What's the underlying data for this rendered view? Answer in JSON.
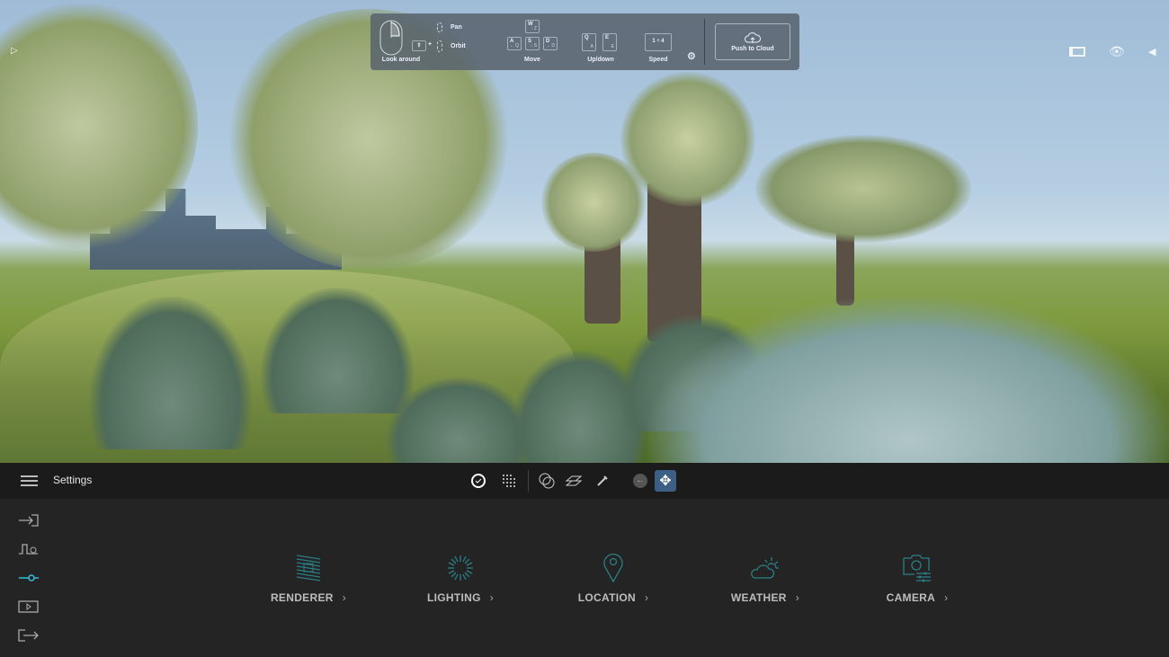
{
  "controls": {
    "look_around": "Look around",
    "pan": "Pan",
    "orbit": "Orbit",
    "shift_key": "⇧",
    "plus": "+",
    "move": "Move",
    "keys": [
      {
        "key": "W",
        "sub": "↑ Z"
      },
      {
        "key": "A",
        "sub": "← Q"
      },
      {
        "key": "S",
        "sub": "↓ S"
      },
      {
        "key": "D",
        "sub": "→ D"
      }
    ],
    "updown": "Up/down",
    "updown_keys": [
      {
        "key": "Q",
        "sub": "A"
      },
      {
        "key": "E",
        "sub": "E"
      }
    ],
    "speed": "Speed",
    "speed_key": "1 ÷ 4",
    "push_to_cloud": "Push to Cloud"
  },
  "toolbar": {
    "title": "Settings"
  },
  "categories": [
    {
      "label": "RENDERER",
      "icon": "renderer-icon"
    },
    {
      "label": "LIGHTING",
      "icon": "sun-icon"
    },
    {
      "label": "LOCATION",
      "icon": "location-pin-icon"
    },
    {
      "label": "WEATHER",
      "icon": "cloud-sun-icon"
    },
    {
      "label": "CAMERA",
      "icon": "camera-icon"
    }
  ],
  "chevron": "›",
  "colors": {
    "accent": "#2fc3d6",
    "icon_teal": "#2a7f86",
    "active_button": "#3b5f85"
  }
}
